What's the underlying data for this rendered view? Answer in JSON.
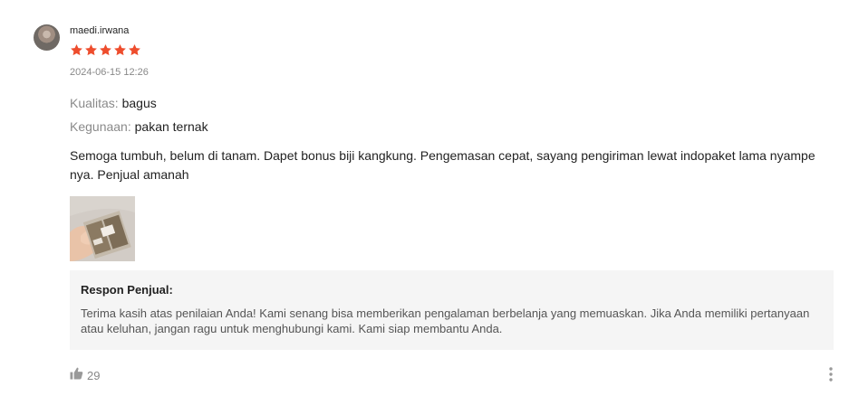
{
  "review": {
    "username": "maedi.irwana",
    "rating": 5,
    "max_rating": 5,
    "star_color": "#ee4d2d",
    "timestamp": "2024-06-15 12:26",
    "attributes": [
      {
        "key": "Kualitas:",
        "value": "bagus"
      },
      {
        "key": "Kegunaan:",
        "value": "pakan ternak"
      }
    ],
    "comment": "Semoga tumbuh, belum di tanam. Dapet bonus biji kangkung. Pengemasan cepat, sayang pengiriman lewat indopaket lama nyampe nya. Penjual amanah",
    "seller_response": {
      "title": "Respon Penjual:",
      "text": "Terima kasih atas penilaian Anda! Kami senang bisa memberikan pengalaman berbelanja yang memuaskan. Jika Anda memiliki pertanyaan atau keluhan, jangan ragu untuk menghubungi kami. Kami siap membantu Anda."
    },
    "likes": "29",
    "icons": {
      "avatar": "user-avatar",
      "star": "star-icon",
      "like": "thumbs-up-icon",
      "more": "more-vertical-icon"
    }
  }
}
